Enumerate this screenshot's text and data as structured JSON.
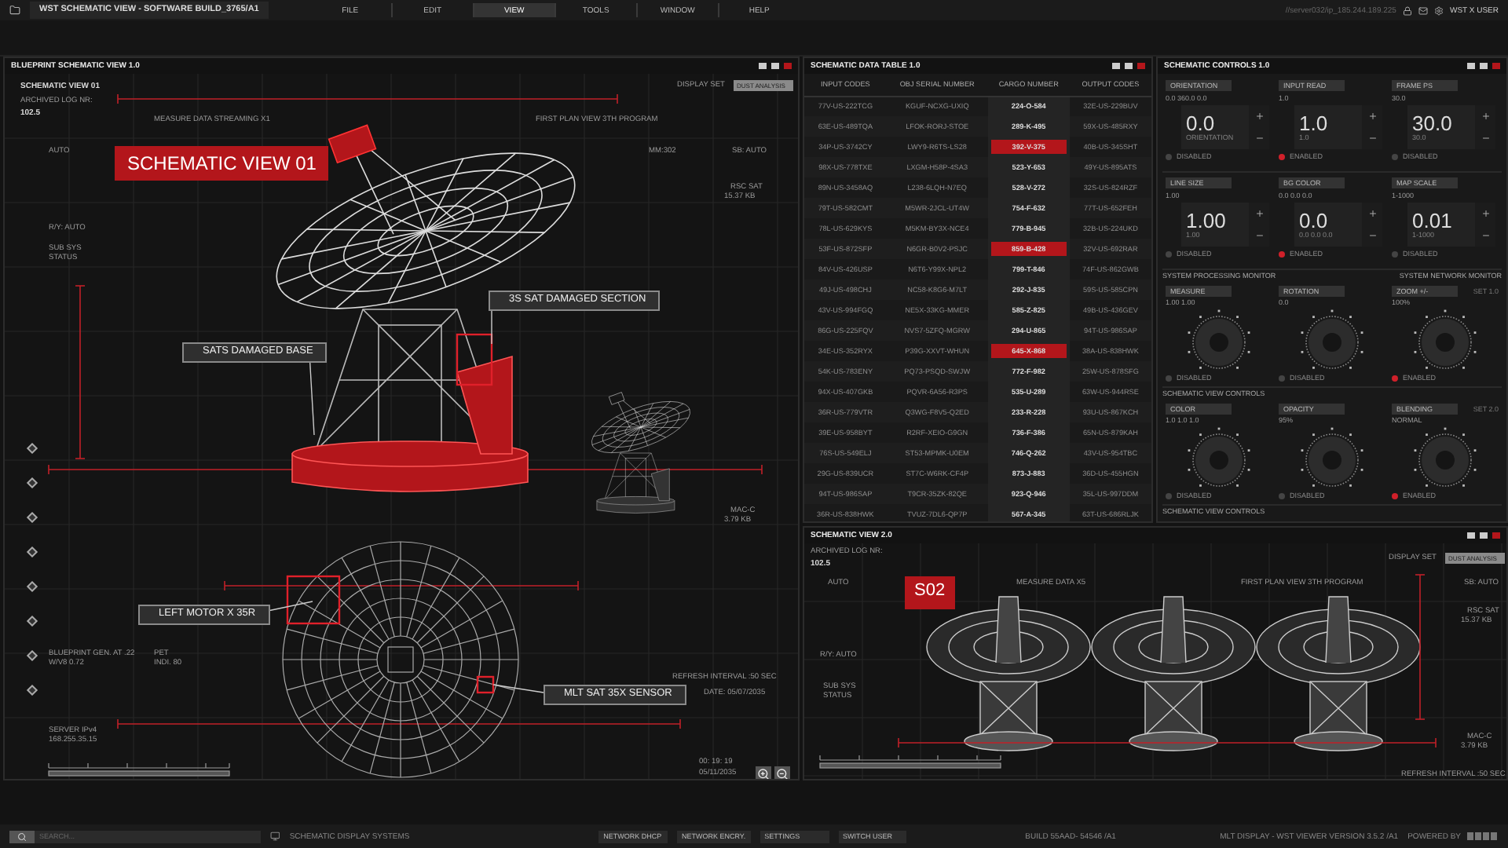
{
  "window": {
    "title": "WST SCHEMATIC VIEW - SOFTWARE BUILD_3765/A1",
    "server": "//server032/ip_185.244.189.225",
    "user": "WST X USER",
    "menu": [
      {
        "label": "FILE",
        "selected": false
      },
      {
        "label": "EDIT",
        "selected": false
      },
      {
        "label": "VIEW",
        "selected": true
      },
      {
        "label": "TOOLS",
        "selected": false
      },
      {
        "label": "WINDOW",
        "selected": false
      },
      {
        "label": "HELP",
        "selected": false
      }
    ]
  },
  "blueprint": {
    "title": "BLUEPRINT SCHEMATIC VIEW 1.0",
    "view_name": "SCHEMATIC VIEW 01",
    "log_label": "ARCHIVED LOG NR:",
    "log_value": "102.5",
    "display_set_label": "DISPLAY SET",
    "display_set_value": "DUST ANALYSIS",
    "banner": "SCHEMATIC VIEW 01",
    "notes": [
      "MEASURE DATA STREAMING X1",
      "FIRST PLAN VIEW 3TH PROGRAM",
      "AUTO",
      "MM:302",
      "SB: AUTO",
      "RSC SAT",
      "15.37 KB",
      "R/Y: AUTO",
      "SUB SYS",
      "STATUS",
      "MAC-C",
      "3.79 KB",
      "BLUEPRINT GEN. AT .22",
      "W/V8 0.72",
      "PET",
      "INDI. 80",
      "REFRESH INTERVAL :50 SEC",
      "DATE: 05/07/2035",
      "SERVER IPv4",
      "168.255.35.15",
      "00: 19: 19",
      "05/11/2035"
    ],
    "callouts": [
      "3S SAT DAMAGED SECTION",
      "SATS DAMAGED BASE",
      "LEFT MOTOR X 35R",
      "MLT SAT 35X SENSOR"
    ]
  },
  "table": {
    "title": "SCHEMATIC DATA TABLE 1.0",
    "columns": [
      "INPUT CODES",
      "OBJ SERIAL NUMBER",
      "CARGO NUMBER",
      "OUTPUT CODES"
    ],
    "rows": [
      {
        "cells": [
          "77V-US-222TCG",
          "KGUF-NCXG-UXIQ",
          "224-O-584",
          "32E-US-229BUV"
        ],
        "selected": false
      },
      {
        "cells": [
          "63E-US-489TQA",
          "LFOK-RORJ-STOE",
          "289-K-495",
          "59X-US-485RXY"
        ],
        "selected": false
      },
      {
        "cells": [
          "34P-US-3742CY",
          "LWY9-R6TS-LS28",
          "392-V-375",
          "40B-US-345SHT"
        ],
        "selected": true
      },
      {
        "cells": [
          "98X-US-778TXE",
          "LXGM-H58P-4SA3",
          "523-Y-653",
          "49Y-US-895ATS"
        ],
        "selected": false
      },
      {
        "cells": [
          "89N-US-3458AQ",
          "L238-6LQH-N7EQ",
          "528-V-272",
          "32S-US-824RZF"
        ],
        "selected": false
      },
      {
        "cells": [
          "79T-US-582CMT",
          "M5WR-2JCL-UT4W",
          "754-F-632",
          "77T-US-652FEH"
        ],
        "selected": false
      },
      {
        "cells": [
          "78L-US-629KYS",
          "M5KM-BY3X-NCE4",
          "779-B-945",
          "32B-US-224UKD"
        ],
        "selected": false
      },
      {
        "cells": [
          "53F-US-872SFP",
          "N6GR-B0V2-PSJC",
          "859-B-428",
          "32V-US-692RAR"
        ],
        "selected": true
      },
      {
        "cells": [
          "84V-US-426USP",
          "N6T6-Y99X-NPL2",
          "799-T-846",
          "74F-US-862GWB"
        ],
        "selected": false
      },
      {
        "cells": [
          "49J-US-498CHJ",
          "NC58-K8G6-M7LT",
          "292-J-835",
          "59S-US-585CPN"
        ],
        "selected": false
      },
      {
        "cells": [
          "43V-US-994FGQ",
          "NE5X-33KG-MMER",
          "585-Z-825",
          "49B-US-436GEV"
        ],
        "selected": false
      },
      {
        "cells": [
          "86G-US-225FQV",
          "NVS7-5ZFQ-MGRW",
          "294-U-865",
          "94T-US-986SAP"
        ],
        "selected": false
      },
      {
        "cells": [
          "34E-US-352RYX",
          "P39G-XXVT-WHUN",
          "645-X-868",
          "38A-US-838HWK"
        ],
        "selected": true
      },
      {
        "cells": [
          "54K-US-783ENY",
          "PQ73-PSQD-SWJW",
          "772-F-982",
          "25W-US-878SFG"
        ],
        "selected": false
      },
      {
        "cells": [
          "94X-US-407GKB",
          "PQVR-6A56-R3PS",
          "535-U-289",
          "63W-US-944RSE"
        ],
        "selected": false
      },
      {
        "cells": [
          "36R-US-779VTR",
          "Q3WG-F8V5-Q2ED",
          "233-R-228",
          "93U-US-867KCH"
        ],
        "selected": false
      },
      {
        "cells": [
          "39E-US-958BYT",
          "R2RF-XEIO-G9GN",
          "736-F-386",
          "65N-US-879KAH"
        ],
        "selected": false
      },
      {
        "cells": [
          "76S-US-549ELJ",
          "ST53-MPMK-U0EM",
          "746-Q-262",
          "43V-US-954TBC"
        ],
        "selected": false
      },
      {
        "cells": [
          "29G-US-839UCR",
          "ST7C-W6RK-CF4P",
          "873-J-883",
          "36D-US-455HGN"
        ],
        "selected": false
      },
      {
        "cells": [
          "94T-US-986SAP",
          "T9CR-35ZK-82QE",
          "923-Q-946",
          "35L-US-997DDM"
        ],
        "selected": false
      },
      {
        "cells": [
          "36R-US-838HWK",
          "TVUZ-7DL6-QP7P",
          "567-A-345",
          "63T-US-686RLJK"
        ],
        "selected": false
      }
    ]
  },
  "controls": {
    "title": "SCHEMATIC CONTROLS 1.0",
    "sections": [
      {
        "kind": "numeric",
        "items": [
          {
            "label": "ORIENTATION",
            "sub": "0.0 360.0 0.0",
            "value": "0.0",
            "hint": "ORIENTATION",
            "status": "DISABLED",
            "enabled": false
          },
          {
            "label": "INPUT READ",
            "sub": "1.0",
            "value": "1.0",
            "hint": "1.0",
            "status": "ENABLED",
            "enabled": true
          },
          {
            "label": "FRAME PS",
            "sub": "30.0",
            "value": "30.0",
            "hint": "30.0",
            "status": "DISABLED",
            "enabled": false
          },
          {
            "label": "LINE SIZE",
            "sub": "1.00",
            "value": "1.00",
            "hint": "1.00",
            "status": "DISABLED",
            "enabled": false
          },
          {
            "label": "BG COLOR",
            "sub": "0.0 0.0 0.0",
            "value": "0.0",
            "hint": "0.0 0.0 0.0",
            "status": "ENABLED",
            "enabled": true
          },
          {
            "label": "MAP SCALE",
            "sub": "1-1000",
            "value": "0.01",
            "hint": "1-1000",
            "status": "DISABLED",
            "enabled": false
          }
        ]
      },
      {
        "kind": "label",
        "left": "SYSTEM PROCESSING MONITOR",
        "right": "SYSTEM NETWORK MONITOR"
      },
      {
        "kind": "knobs",
        "items": [
          {
            "label": "MEASURE",
            "sub": "1.00 1.00",
            "status": "DISABLED",
            "enabled": false
          },
          {
            "label": "ROTATION",
            "sub": "0.0",
            "status": "DISABLED",
            "enabled": false
          },
          {
            "label": "ZOOM +/-",
            "sub": "100%",
            "status": "ENABLED",
            "enabled": true,
            "tag": "SET 1.0"
          }
        ]
      },
      {
        "kind": "label",
        "left": "SCHEMATIC VIEW CONTROLS"
      },
      {
        "kind": "knobs",
        "items": [
          {
            "label": "COLOR",
            "sub": "1.0 1.0 1.0",
            "status": "DISABLED",
            "enabled": false
          },
          {
            "label": "OPACITY",
            "sub": "95%",
            "status": "DISABLED",
            "enabled": false
          },
          {
            "label": "BLENDING",
            "sub": "NORMAL",
            "status": "ENABLED",
            "enabled": true,
            "tag": "SET 2.0"
          }
        ]
      },
      {
        "kind": "label",
        "left": "SCHEMATIC VIEW CONTROLS"
      }
    ]
  },
  "view2": {
    "title": "SCHEMATIC VIEW 2.0",
    "log_label": "ARCHIVED LOG NR:",
    "log_value": "102.5",
    "display_set_label": "DISPLAY SET",
    "display_set_value": "DUST ANALYSIS",
    "banner": "S02",
    "notes": [
      "AUTO",
      "MEASURE DATA X5",
      "FIRST PLAN VIEW 3TH PROGRAM",
      "SB: AUTO",
      "RSC SAT",
      "15.37 KB",
      "R/Y: AUTO",
      "SUB SYS",
      "STATUS",
      "MAC-C",
      "3.79 KB",
      "REFRESH INTERVAL :50 SEC"
    ]
  },
  "status_bar": {
    "search_placeholder": "SEARCH...",
    "system": "SCHEMATIC DISPLAY SYSTEMS",
    "buttons": [
      "NETWORK DHCP",
      "NETWORK ENCRY.",
      "SETTINGS",
      "SWITCH USER"
    ],
    "build": "BUILD 55AAD- 54546 /A1",
    "version": "MLT DISPLAY - WST VIEWER VERSION 3.5.2 /A1",
    "powered": "POWERED BY"
  }
}
